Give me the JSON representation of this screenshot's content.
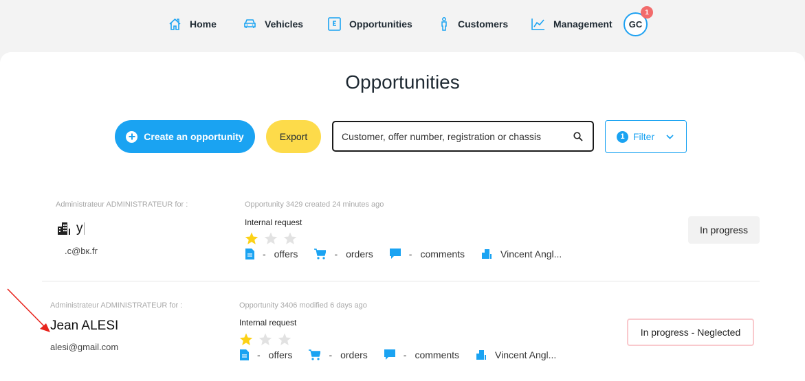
{
  "nav": {
    "home": "Home",
    "vehicles": "Vehicles",
    "opportunities": "Opportunities",
    "customers": "Customers",
    "management": "Management",
    "avatar_initials": "GC",
    "notification_count": "1"
  },
  "page": {
    "title": "Opportunities"
  },
  "toolbar": {
    "create_label": "Create an opportunity",
    "export_label": "Export",
    "search_placeholder": "Customer, offer number, registration or chassis",
    "filter_count": "1",
    "filter_label": "Filter"
  },
  "opportunities": [
    {
      "for_line": "Administrateur ADMINISTRATEUR for :",
      "customer_name": "y",
      "customer_email": ".c@bк.fr",
      "opportunity_line": "Opportunity 3429 created 24 minutes ago",
      "type": "Internal request",
      "rating": 1,
      "rating_max": 3,
      "offers_count": "-",
      "offers_label": "offers",
      "orders_count": "-",
      "orders_label": "orders",
      "comments_count": "-",
      "comments_label": "comments",
      "dealer": "Vincent Angl...",
      "status": "In progress"
    },
    {
      "for_line": "Administrateur ADMINISTRATEUR for :",
      "customer_name": "Jean ALESI",
      "customer_email": "alesi@gmail.com",
      "opportunity_line": "Opportunity 3406 modified 6 days ago",
      "type": "Internal request",
      "rating": 1,
      "rating_max": 3,
      "offers_count": "-",
      "offers_label": "offers",
      "orders_count": "-",
      "orders_label": "orders",
      "comments_count": "-",
      "comments_label": "comments",
      "dealer": "Vincent Angl...",
      "status": "In progress - Neglected"
    }
  ],
  "colors": {
    "accent": "#1aa3f2",
    "export": "#fddb4a",
    "star_on": "#fcd116",
    "star_off": "#e2e2e2",
    "badge": "#f26b6b",
    "annotation_arrow": "#e8231c"
  }
}
